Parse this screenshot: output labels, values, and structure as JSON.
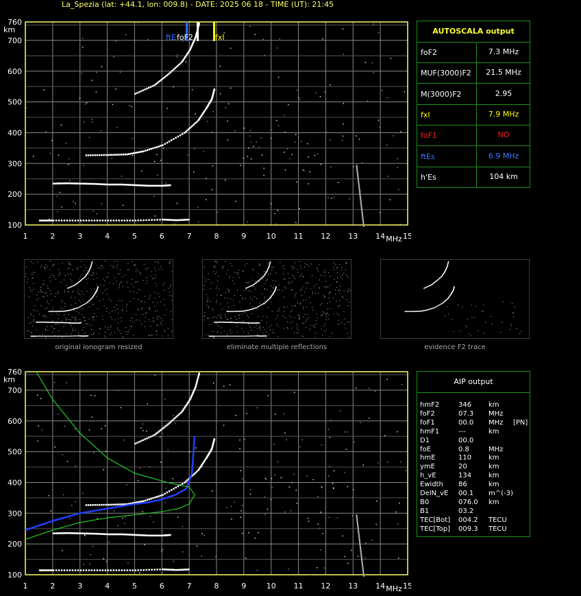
{
  "header": "La_Spezia (lat: +44.1, lon: 009.8) - DATE: 2025 06 18 - TIME (UT): 21:45",
  "axes": {
    "y_ticks": [
      "760",
      "700",
      "600",
      "500",
      "400",
      "300",
      "200",
      "100"
    ],
    "y_unit": "km",
    "x_ticks": [
      "1",
      "2",
      "3",
      "4",
      "5",
      "6",
      "7",
      "8",
      "9",
      "10",
      "11",
      "12",
      "13",
      "14",
      "15"
    ],
    "x_unit": "MHz"
  },
  "markers": {
    "ftE": "ftE",
    "foF2": "foF2",
    "fxI": "fxI"
  },
  "colors": {
    "grid": "#8a8a8a",
    "frame": "#ffff66",
    "trace_blue": "#2040ff",
    "profile_green": "#22cc22",
    "fxI": "#ffff00",
    "ftE": "#3070ff",
    "foF1": "#ff2020",
    "box": "#1e8f1e"
  },
  "thumbnails": {
    "labels": [
      "original ionogram resized",
      "eliminate multiple reflections",
      "evidence F2 trace"
    ]
  },
  "autoscala": {
    "title": "AUTOSCALA output",
    "rows": [
      {
        "name": "foF2",
        "value": "7.3 MHz",
        "color": "#ffffff"
      },
      {
        "name": "MUF(3000)F2",
        "value": "21.5 MHz",
        "color": "#ffffff"
      },
      {
        "name": "M(3000)F2",
        "value": "2.95",
        "color": "#ffffff"
      },
      {
        "name": "fxI",
        "value": "7.9 MHz",
        "color": "#ffff00"
      },
      {
        "name": "foF1",
        "value": "NO",
        "color": "#ff2020"
      },
      {
        "name": "ftEs",
        "value": "6.9 MHz",
        "color": "#3a7bff"
      },
      {
        "name": "h'Es",
        "value": "104    km",
        "color": "#ffffff"
      }
    ]
  },
  "aip": {
    "title": "AIP output",
    "rows": [
      [
        "hmF2",
        "346",
        "km",
        ""
      ],
      [
        "foF2",
        "07.3",
        "MHz",
        ""
      ],
      [
        "foF1",
        "00.0",
        "MHz",
        "[PN]"
      ],
      [
        "hmF1",
        "---",
        "km",
        ""
      ],
      [
        "D1",
        "00.0",
        "",
        ""
      ],
      [
        "foE",
        "0.8",
        "MHz",
        ""
      ],
      [
        "hmE",
        "110",
        "km",
        ""
      ],
      [
        "ymE",
        "20",
        "km",
        ""
      ],
      [
        "h_vE",
        "134",
        "km",
        ""
      ],
      [
        "Ewidth",
        "86",
        "km",
        ""
      ],
      [
        "DelN_vE",
        "00.1",
        "m^(-3)",
        ""
      ],
      [
        "B0",
        "076.0",
        "km",
        ""
      ],
      [
        "B1",
        "03.2",
        "",
        ""
      ],
      [
        "TEC[Bot]",
        "004.2",
        "TECU",
        ""
      ],
      [
        "TEC[Top]",
        "009.3",
        "TECU",
        ""
      ]
    ]
  },
  "chart_data": [
    {
      "type": "scatter",
      "title": "",
      "xlabel": "MHz",
      "ylabel": "km",
      "xlim": [
        1,
        15
      ],
      "ylim": [
        100,
        760
      ],
      "grid": true,
      "series": [
        {
          "x": [
            1.5,
            2,
            3,
            4,
            5,
            6,
            6.5,
            7.0
          ],
          "y": [
            115,
            115,
            115,
            115,
            115,
            118,
            116,
            118
          ]
        },
        {
          "x": [
            2.0,
            2.5,
            3,
            3.5,
            4,
            4.5,
            5,
            5.5,
            6.0,
            6.3
          ],
          "y": [
            235,
            236,
            235,
            234,
            232,
            232,
            230,
            228,
            228,
            230
          ]
        },
        {
          "x": [
            3.2,
            4,
            4.7,
            5.3,
            6,
            6.8,
            7.3,
            7.6,
            7.8,
            7.9
          ],
          "y": [
            327,
            328,
            330,
            340,
            360,
            400,
            440,
            480,
            510,
            545
          ]
        },
        {
          "x": [
            5,
            5.7,
            6.2,
            6.7,
            7.0,
            7.2,
            7.35
          ],
          "y": [
            527,
            555,
            590,
            630,
            670,
            710,
            760
          ]
        }
      ],
      "markers": [
        {
          "label": "ftE",
          "x": 6.9
        },
        {
          "label": "foF2",
          "x": 7.3
        },
        {
          "label": "fxI",
          "x": 7.9
        }
      ]
    },
    {
      "type": "line",
      "title": "",
      "xlabel": "MHz",
      "ylabel": "km",
      "xlim": [
        1,
        15
      ],
      "ylim": [
        100,
        760
      ],
      "series": [
        {
          "x": [
            1.0,
            2,
            3,
            4,
            5,
            5.5,
            6,
            6.5,
            6.9,
            7.1,
            7.2
          ],
          "y": [
            245,
            275,
            300,
            315,
            330,
            335,
            345,
            360,
            380,
            430,
            550
          ]
        },
        {
          "x": [
            1.0,
            2,
            3,
            4,
            5,
            6,
            6.6,
            7.0,
            7.2,
            7.0,
            6.2,
            5,
            4,
            3,
            2,
            1.4
          ],
          "y": [
            215,
            245,
            270,
            285,
            295,
            305,
            315,
            330,
            360,
            385,
            400,
            430,
            480,
            560,
            670,
            760
          ]
        }
      ]
    }
  ]
}
